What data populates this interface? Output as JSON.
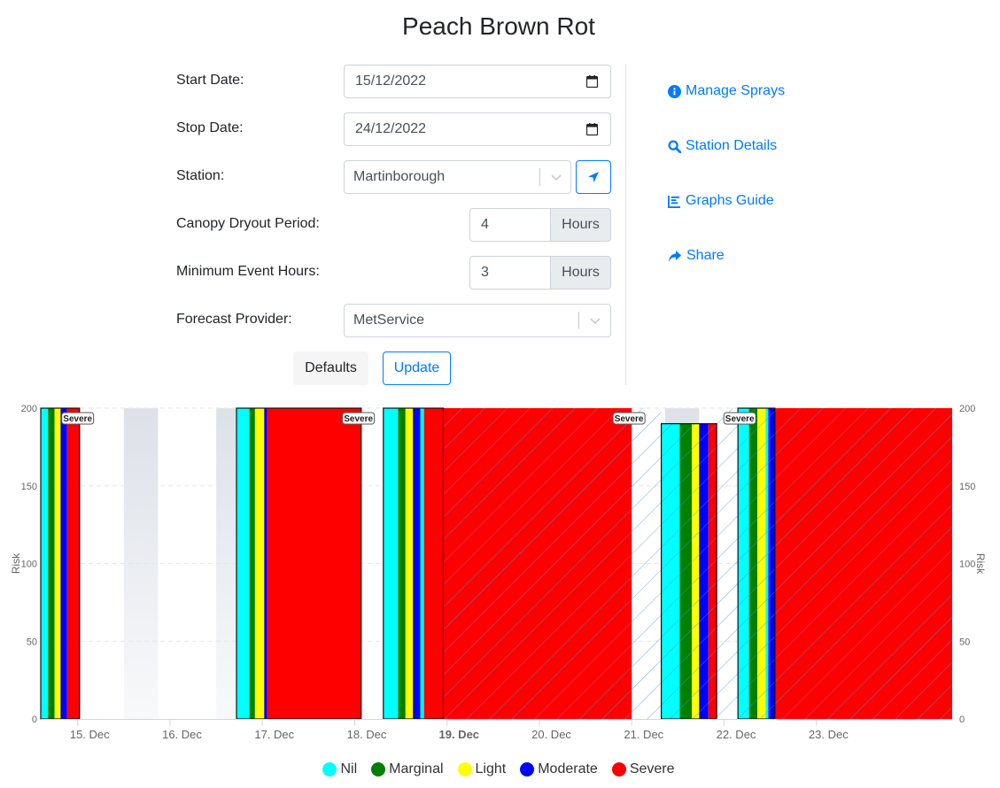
{
  "page": {
    "title": "Peach Brown Rot"
  },
  "form": {
    "start_date": {
      "label": "Start Date:",
      "value": "15/12/2022"
    },
    "stop_date": {
      "label": "Stop Date:",
      "value": "24/12/2022"
    },
    "station": {
      "label": "Station:",
      "value": "Martinborough"
    },
    "canopy": {
      "label": "Canopy Dryout Period:",
      "value": "4",
      "unit": "Hours"
    },
    "min_event": {
      "label": "Minimum Event Hours:",
      "value": "3",
      "unit": "Hours"
    },
    "forecast": {
      "label": "Forecast Provider:",
      "value": "MetService"
    },
    "defaults_label": "Defaults",
    "update_label": "Update"
  },
  "links": {
    "manage_sprays": "Manage Sprays",
    "station_details": "Station Details",
    "graphs_guide": "Graphs Guide",
    "share": "Share"
  },
  "colors": {
    "Nil": "#00ffff",
    "Marginal": "#008000",
    "Light": "#ffff00",
    "Moderate": "#0000ff",
    "Severe": "#ff0000",
    "link": "#007bff"
  },
  "chart_data": {
    "type": "bar",
    "ylabel": "Risk",
    "ylabel_right": "Risk",
    "ylim": [
      0,
      200
    ],
    "y_ticks": [
      0,
      50,
      100,
      150,
      200
    ],
    "x_range": [
      14.6,
      24.47
    ],
    "x_ticks": [
      {
        "day": 15,
        "label": "15. Dec"
      },
      {
        "day": 16,
        "label": "16. Dec"
      },
      {
        "day": 17,
        "label": "17. Dec"
      },
      {
        "day": 18,
        "label": "18. Dec"
      },
      {
        "day": 19,
        "label": "19. Dec",
        "bold": true
      },
      {
        "day": 20,
        "label": "20. Dec"
      },
      {
        "day": 21,
        "label": "21. Dec"
      },
      {
        "day": 22,
        "label": "22. Dec"
      },
      {
        "day": 23,
        "label": "23. Dec"
      }
    ],
    "legend": [
      "Nil",
      "Marginal",
      "Light",
      "Moderate",
      "Severe"
    ],
    "legend_position": "bottom-center",
    "bars": [
      {
        "start": 14.6,
        "end": 14.68,
        "risk": "Nil",
        "value": 200
      },
      {
        "start": 14.68,
        "end": 14.75,
        "risk": "Marginal",
        "value": 200
      },
      {
        "start": 14.75,
        "end": 14.815,
        "risk": "Light",
        "value": 200
      },
      {
        "start": 14.815,
        "end": 14.885,
        "risk": "Moderate",
        "value": 200
      },
      {
        "start": 14.885,
        "end": 15.02,
        "risk": "Severe",
        "value": 200
      },
      {
        "start": 16.72,
        "end": 16.86,
        "risk": "Nil",
        "value": 200
      },
      {
        "start": 16.86,
        "end": 16.92,
        "risk": "Marginal",
        "value": 200
      },
      {
        "start": 16.92,
        "end": 17.02,
        "risk": "Light",
        "value": 200
      },
      {
        "start": 17.02,
        "end": 17.05,
        "risk": "Moderate",
        "value": 200
      },
      {
        "start": 17.05,
        "end": 18.07,
        "risk": "Severe",
        "value": 200
      },
      {
        "start": 18.31,
        "end": 18.47,
        "risk": "Nil",
        "value": 200
      },
      {
        "start": 18.47,
        "end": 18.55,
        "risk": "Marginal",
        "value": 200
      },
      {
        "start": 18.55,
        "end": 18.63,
        "risk": "Light",
        "value": 200
      },
      {
        "start": 18.63,
        "end": 18.71,
        "risk": "Moderate",
        "value": 200
      },
      {
        "start": 18.71,
        "end": 18.75,
        "risk": "Nil",
        "value": 200
      },
      {
        "start": 18.75,
        "end": 18.96,
        "risk": "Severe",
        "value": 200
      },
      {
        "start": 18.96,
        "end": 21.0,
        "risk": "Severe",
        "value": 200,
        "forecast": true
      },
      {
        "start": 21.32,
        "end": 21.52,
        "risk": "Nil",
        "value": 190,
        "forecast": true
      },
      {
        "start": 21.52,
        "end": 21.65,
        "risk": "Marginal",
        "value": 190,
        "forecast": true
      },
      {
        "start": 21.65,
        "end": 21.73,
        "risk": "Light",
        "value": 190,
        "forecast": true
      },
      {
        "start": 21.73,
        "end": 21.83,
        "risk": "Moderate",
        "value": 190,
        "forecast": true
      },
      {
        "start": 21.83,
        "end": 21.92,
        "risk": "Severe",
        "value": 190,
        "forecast": true
      },
      {
        "start": 22.15,
        "end": 22.27,
        "risk": "Nil",
        "value": 200,
        "forecast": true
      },
      {
        "start": 22.27,
        "end": 22.36,
        "risk": "Marginal",
        "value": 200,
        "forecast": true
      },
      {
        "start": 22.36,
        "end": 22.45,
        "risk": "Light",
        "value": 200,
        "forecast": true
      },
      {
        "start": 22.45,
        "end": 22.48,
        "risk": "Nil",
        "value": 200,
        "forecast": true
      },
      {
        "start": 22.48,
        "end": 22.55,
        "risk": "Moderate",
        "value": 200,
        "forecast": true
      },
      {
        "start": 22.55,
        "end": 24.47,
        "risk": "Severe",
        "value": 200,
        "forecast": true
      }
    ],
    "annotations": [
      {
        "x": 15.0,
        "text": "Severe"
      },
      {
        "x": 18.04,
        "text": "Severe"
      },
      {
        "x": 20.97,
        "text": "Severe"
      },
      {
        "x": 22.17,
        "text": "Severe"
      }
    ]
  }
}
